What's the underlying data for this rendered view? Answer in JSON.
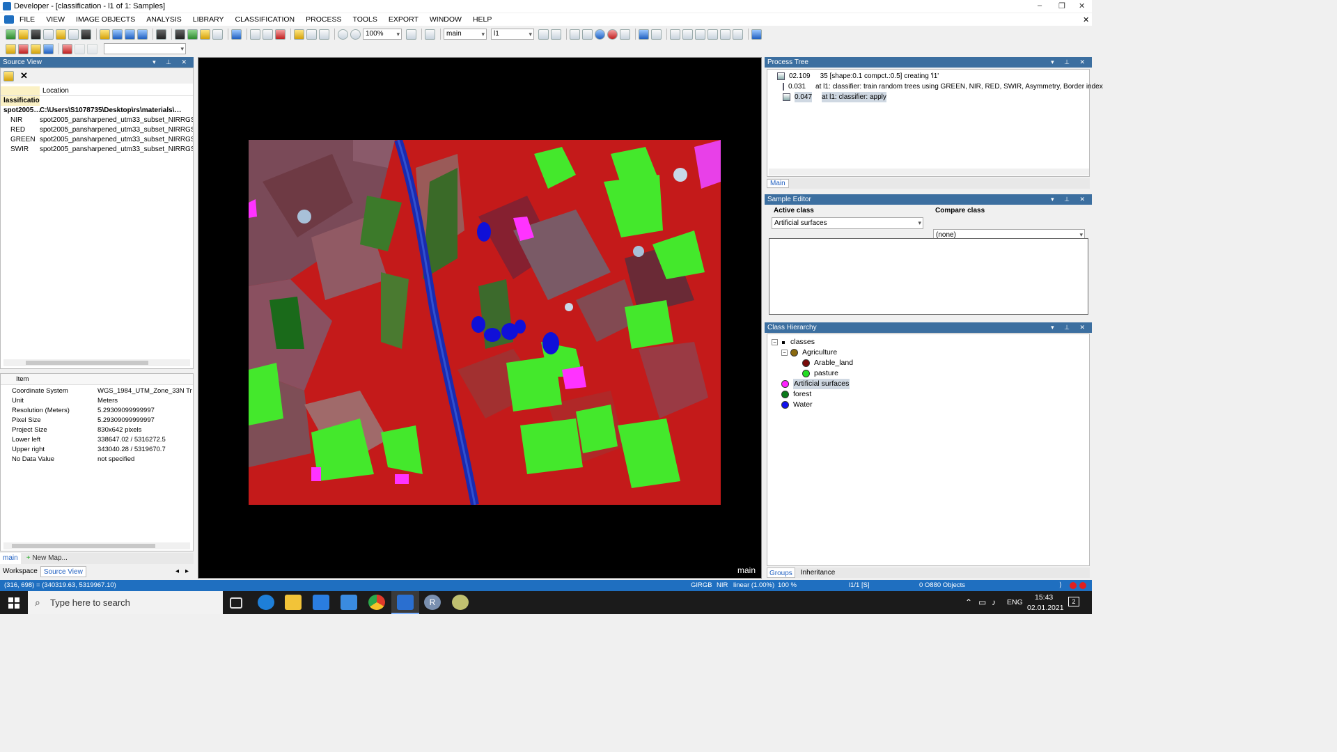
{
  "window": {
    "title": "Developer - [classification - l1 of 1: Samples]",
    "controls": [
      "–",
      "❐",
      "✕"
    ]
  },
  "menu": [
    "FILE",
    "VIEW",
    "IMAGE OBJECTS",
    "ANALYSIS",
    "LIBRARY",
    "CLASSIFICATION",
    "PROCESS",
    "TOOLS",
    "EXPORT",
    "WINDOW",
    "HELP"
  ],
  "toolbar": {
    "zoom": "100%",
    "map_combo": "main",
    "level_combo": "l1"
  },
  "source_view": {
    "title": "Source View",
    "col1": "",
    "col2": "Location",
    "group": "lassification",
    "rows": [
      {
        "name": "spot2005…",
        "location": "C:\\Users\\S1078735\\Desktop\\rs\\materials\\…",
        "bold": true
      },
      {
        "name": "NIR",
        "location": "spot2005_pansharpened_utm33_subset_NIRRGSW…"
      },
      {
        "name": "RED",
        "location": "spot2005_pansharpened_utm33_subset_NIRRGSW…"
      },
      {
        "name": "GREEN",
        "location": "spot2005_pansharpened_utm33_subset_NIRRGSW…"
      },
      {
        "name": "SWIR",
        "location": "spot2005_pansharpened_utm33_subset_NIRRGSW…"
      }
    ]
  },
  "info": {
    "header": "Item",
    "rows": [
      {
        "k": "Coordinate System",
        "v": "WGS_1984_UTM_Zone_33N  Tr"
      },
      {
        "k": "Unit",
        "v": "Meters"
      },
      {
        "k": "Resolution (Meters)",
        "v": "5.29309099999997"
      },
      {
        "k": "Pixel Size",
        "v": "5.29309099999997"
      },
      {
        "k": "Project Size",
        "v": "830x642 pixels"
      },
      {
        "k": "Lower left",
        "v": "338647.02 / 5316272.5"
      },
      {
        "k": "Upper right",
        "v": "343040.28 / 5319670.7"
      },
      {
        "k": "No Data Value",
        "v": "not specified"
      }
    ]
  },
  "left_tabs": {
    "map_tab": "main",
    "new_map": "New Map...",
    "workspace": "Workspace",
    "source": "Source View"
  },
  "map": {
    "label": "main"
  },
  "process_tree": {
    "title": "Process Tree",
    "rows": [
      {
        "time": "02.109",
        "text": "35 [shape:0.1 compct.:0.5] creating 'l1'"
      },
      {
        "time": "0.031",
        "text": "at  l1: classifier: train random trees using GREEN, NIR, RED, SWIR, Asymmetry, Border index"
      },
      {
        "time": "0.047",
        "text": "at  l1: classifier: apply"
      }
    ],
    "tab": "Main"
  },
  "sample_editor": {
    "title": "Sample Editor",
    "active_label": "Active class",
    "active_value": "Artificial surfaces",
    "compare_label": "Compare class",
    "compare_value": "(none)"
  },
  "class_hierarchy": {
    "title": "Class Hierarchy",
    "root": "classes",
    "items": [
      {
        "name": "Agriculture",
        "color": "#8a6a10",
        "indent": 1,
        "expand": true
      },
      {
        "name": "Arable_land",
        "color": "#7a0a0a",
        "indent": 2
      },
      {
        "name": "pasture",
        "color": "#22dd22",
        "indent": 2
      },
      {
        "name": "Artificial surfaces",
        "color": "#ff22ff",
        "indent": 1,
        "selected": true
      },
      {
        "name": "forest",
        "color": "#0a7a1a",
        "indent": 1
      },
      {
        "name": "Water",
        "color": "#1010ee",
        "indent": 1
      }
    ],
    "tabs": [
      "Groups",
      "Inheritance"
    ]
  },
  "status": {
    "coords": "(316, 698) = (340319.63, 5319967.10)",
    "bands": "GIRGB",
    "band": "NIR",
    "stretch": "linear (1.00%)",
    "zoom": "100 %",
    "level": "l1/1  [S]",
    "objects": "0 O880 Objects"
  },
  "taskbar": {
    "search": "Type here to search",
    "time": "15:43",
    "date": "02.01.2021",
    "lang": "ENG",
    "notif": "2"
  },
  "colors": {
    "accent": "#1f6fc0",
    "panel": "#3c6fa0"
  }
}
